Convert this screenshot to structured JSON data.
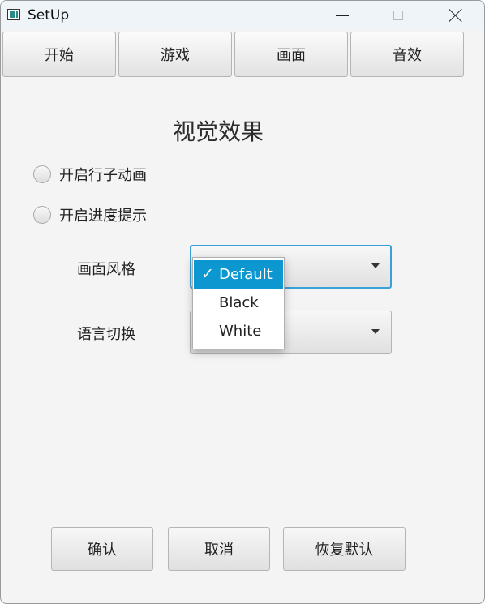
{
  "window": {
    "title": "SetUp",
    "icon": "app-window-icon"
  },
  "tabs": [
    {
      "label": "开始"
    },
    {
      "label": "游戏"
    },
    {
      "label": "画面"
    },
    {
      "label": "音效"
    }
  ],
  "section": {
    "title": "视觉效果"
  },
  "options": {
    "row_animation_label": "开启行子动画",
    "row_animation_checked": false,
    "progress_hint_label": "开启进度提示",
    "progress_hint_checked": false
  },
  "settings": {
    "style_label": "画面风格",
    "style_selected": "Default",
    "style_options": [
      "Default",
      "Black",
      "White"
    ],
    "language_label": "语言切换",
    "language_selected": ""
  },
  "dropdown": {
    "check_glyph": "✓",
    "items": [
      "Default",
      "Black",
      "White"
    ]
  },
  "buttons": {
    "confirm": "确认",
    "cancel": "取消",
    "restore_default": "恢复默认"
  },
  "colors": {
    "accent": "#0c97d0",
    "focus_border": "#3aa0d8",
    "title_bar": "#eef4f8"
  }
}
